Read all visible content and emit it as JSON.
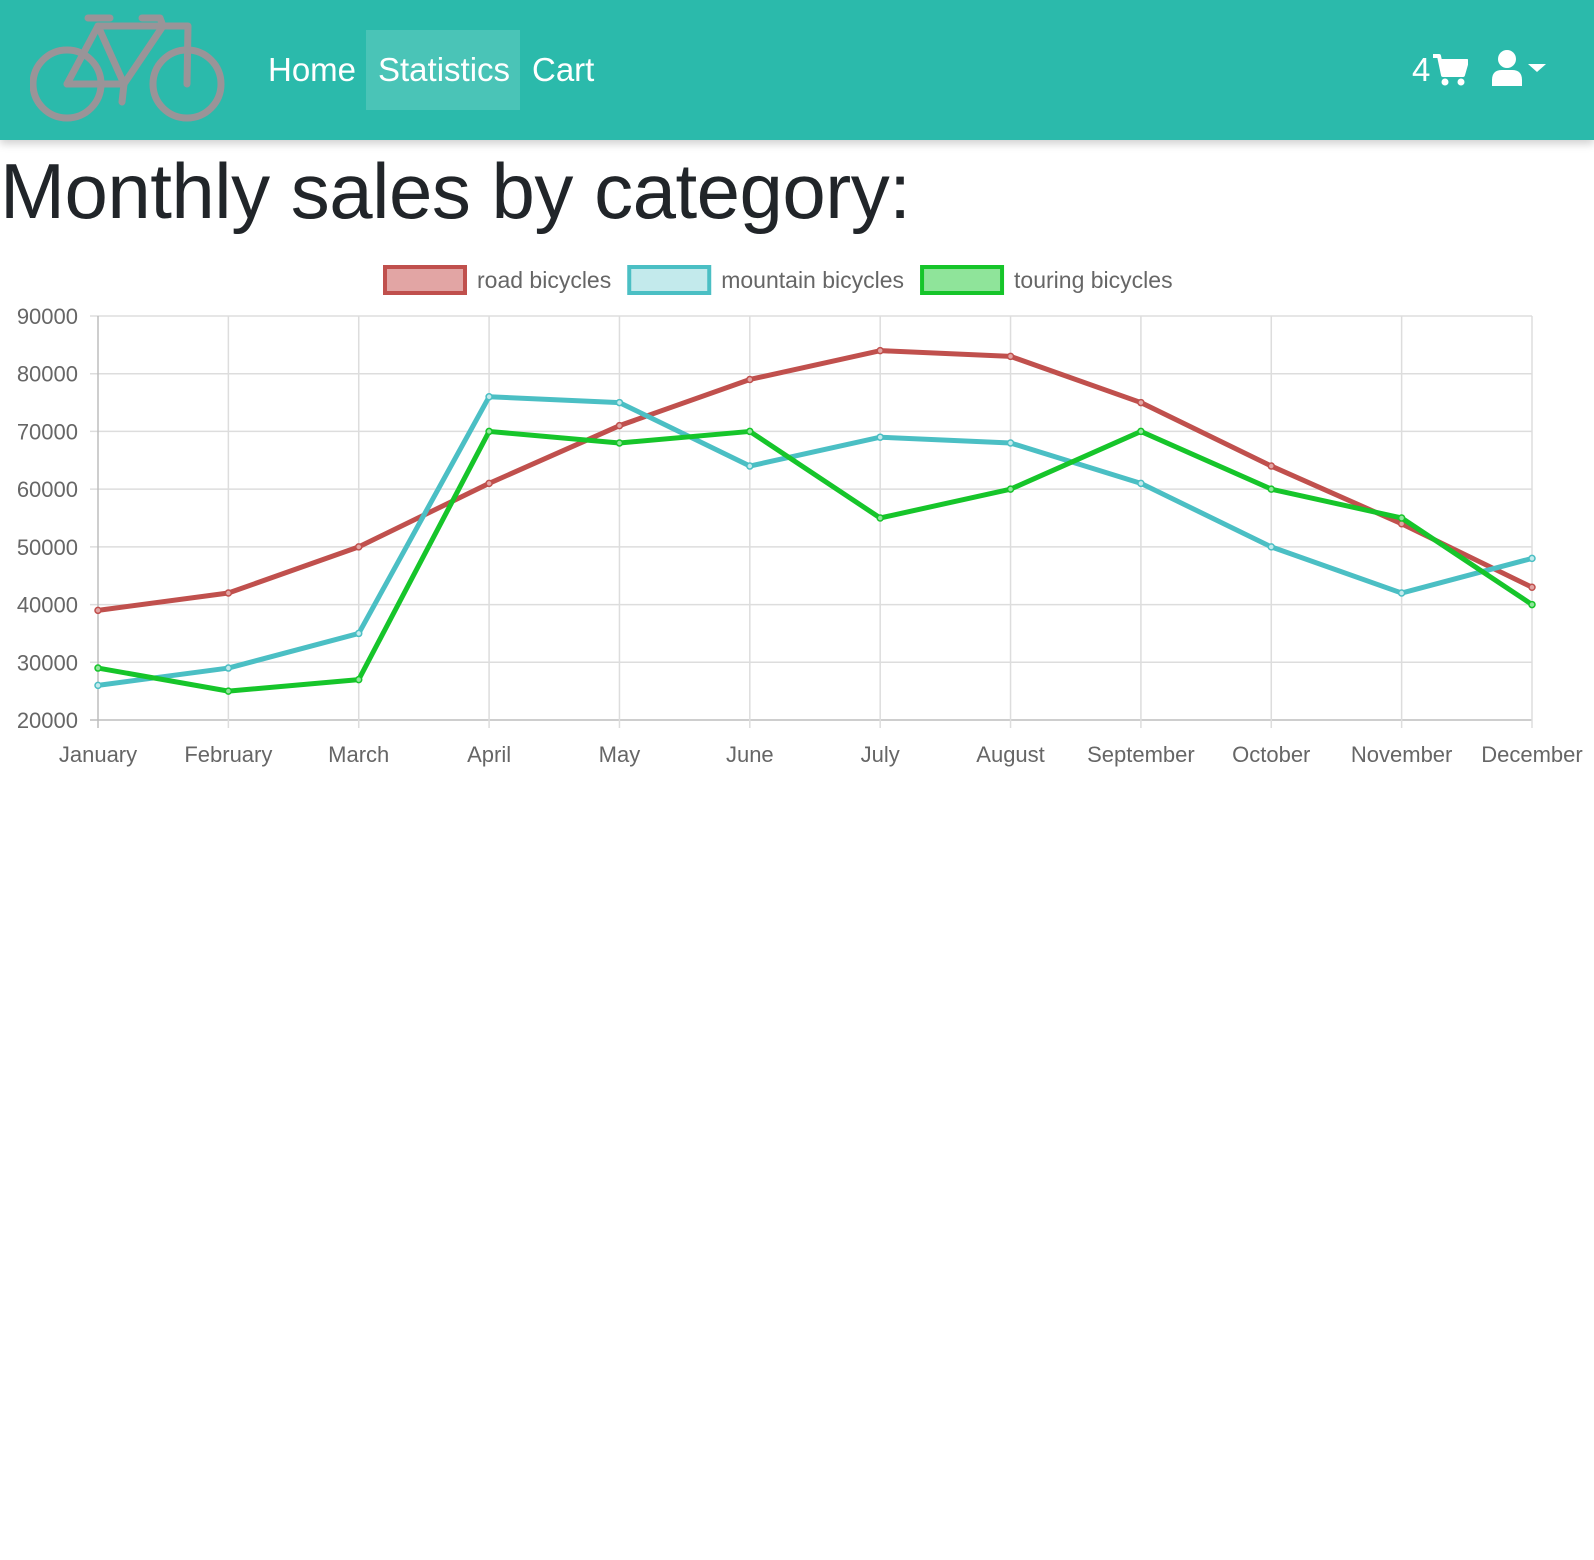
{
  "navbar": {
    "logo_icon": "bicycle-icon",
    "links": [
      {
        "label": "Home",
        "active": false
      },
      {
        "label": "Statistics",
        "active": true
      },
      {
        "label": "Cart",
        "active": false
      }
    ],
    "cart_count": "4",
    "cart_icon": "shopping-cart-icon",
    "user_icon": "user-icon",
    "background_color": "#2bbaab"
  },
  "page": {
    "title": "Monthly sales by category:"
  },
  "chart_data": {
    "type": "line",
    "title": "",
    "xlabel": "",
    "ylabel": "",
    "categories": [
      "January",
      "February",
      "March",
      "April",
      "May",
      "June",
      "July",
      "August",
      "September",
      "October",
      "November",
      "December"
    ],
    "series": [
      {
        "name": "road bicycles",
        "color": "#c0504d",
        "fill": "#e2a5a4",
        "values": [
          39000,
          42000,
          50000,
          61000,
          71000,
          79000,
          84000,
          83000,
          75000,
          64000,
          54000,
          43000
        ]
      },
      {
        "name": "mountain bicycles",
        "color": "#4bbfc4",
        "fill": "#c3eaec",
        "values": [
          26000,
          29000,
          35000,
          76000,
          75000,
          64000,
          69000,
          68000,
          61000,
          50000,
          42000,
          48000
        ]
      },
      {
        "name": "touring bicycles",
        "color": "#16c52a",
        "fill": "#8fe49a",
        "values": [
          29000,
          25000,
          27000,
          70000,
          68000,
          70000,
          55000,
          60000,
          70000,
          60000,
          55000,
          40000
        ]
      }
    ],
    "ylim": [
      20000,
      90000
    ],
    "yticks": [
      "90000",
      "80000",
      "70000",
      "60000",
      "50000",
      "40000",
      "30000",
      "20000"
    ],
    "grid": true,
    "legend": "top-center"
  }
}
